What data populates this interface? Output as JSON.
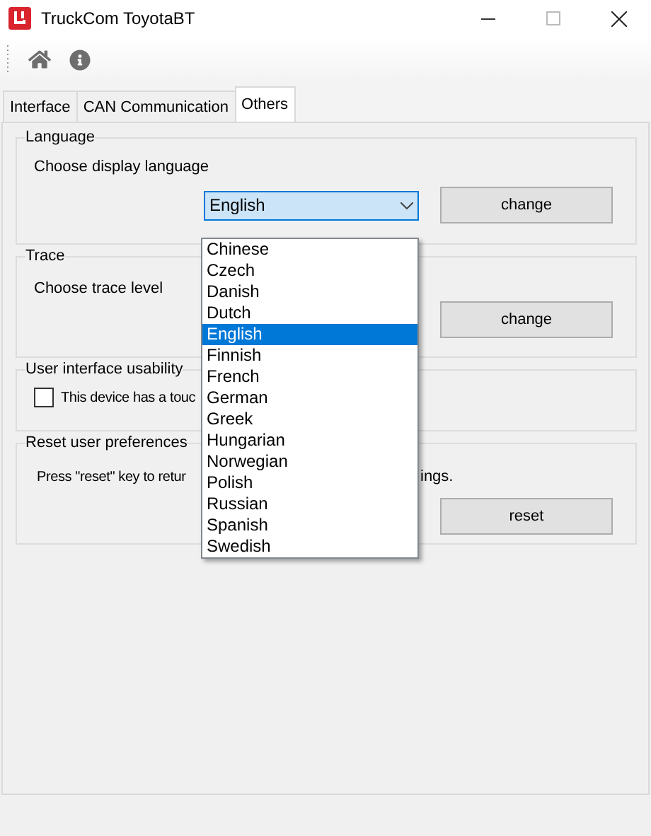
{
  "window": {
    "title": "TruckCom ToyotaBT"
  },
  "toolbar": [
    {
      "kind": "home"
    },
    {
      "kind": "info"
    }
  ],
  "tabs": [
    {
      "label": "Interface",
      "selected": false
    },
    {
      "label": "CAN Communication",
      "selected": false
    },
    {
      "label": "Others",
      "selected": true
    }
  ],
  "language": {
    "title": "Language",
    "prompt": "Choose display language",
    "combo_value": "English",
    "button": "change"
  },
  "trace": {
    "title": "Trace",
    "prompt": "Choose trace level",
    "button": "change"
  },
  "usability": {
    "title": "User interface usability",
    "checkbox_label": "This device has a touc",
    "checked": false
  },
  "reset": {
    "title": "Reset user preferences",
    "prompt_start": "Press \"reset\" key to retur",
    "prompt_end": "ings.",
    "button": "reset"
  },
  "dropdown": {
    "expanded": true,
    "options": [
      {
        "label": "Chinese",
        "selected": false
      },
      {
        "label": "Czech",
        "selected": false
      },
      {
        "label": "Danish",
        "selected": false
      },
      {
        "label": "Dutch",
        "selected": false
      },
      {
        "label": "English",
        "selected": true
      },
      {
        "label": "Finnish",
        "selected": false
      },
      {
        "label": "French",
        "selected": false
      },
      {
        "label": "German",
        "selected": false
      },
      {
        "label": "Greek",
        "selected": false
      },
      {
        "label": "Hungarian",
        "selected": false
      },
      {
        "label": "Norwegian",
        "selected": false
      },
      {
        "label": "Polish",
        "selected": false
      },
      {
        "label": "Russian",
        "selected": false
      },
      {
        "label": "Spanish",
        "selected": false
      },
      {
        "label": "Swedish",
        "selected": false
      }
    ]
  }
}
